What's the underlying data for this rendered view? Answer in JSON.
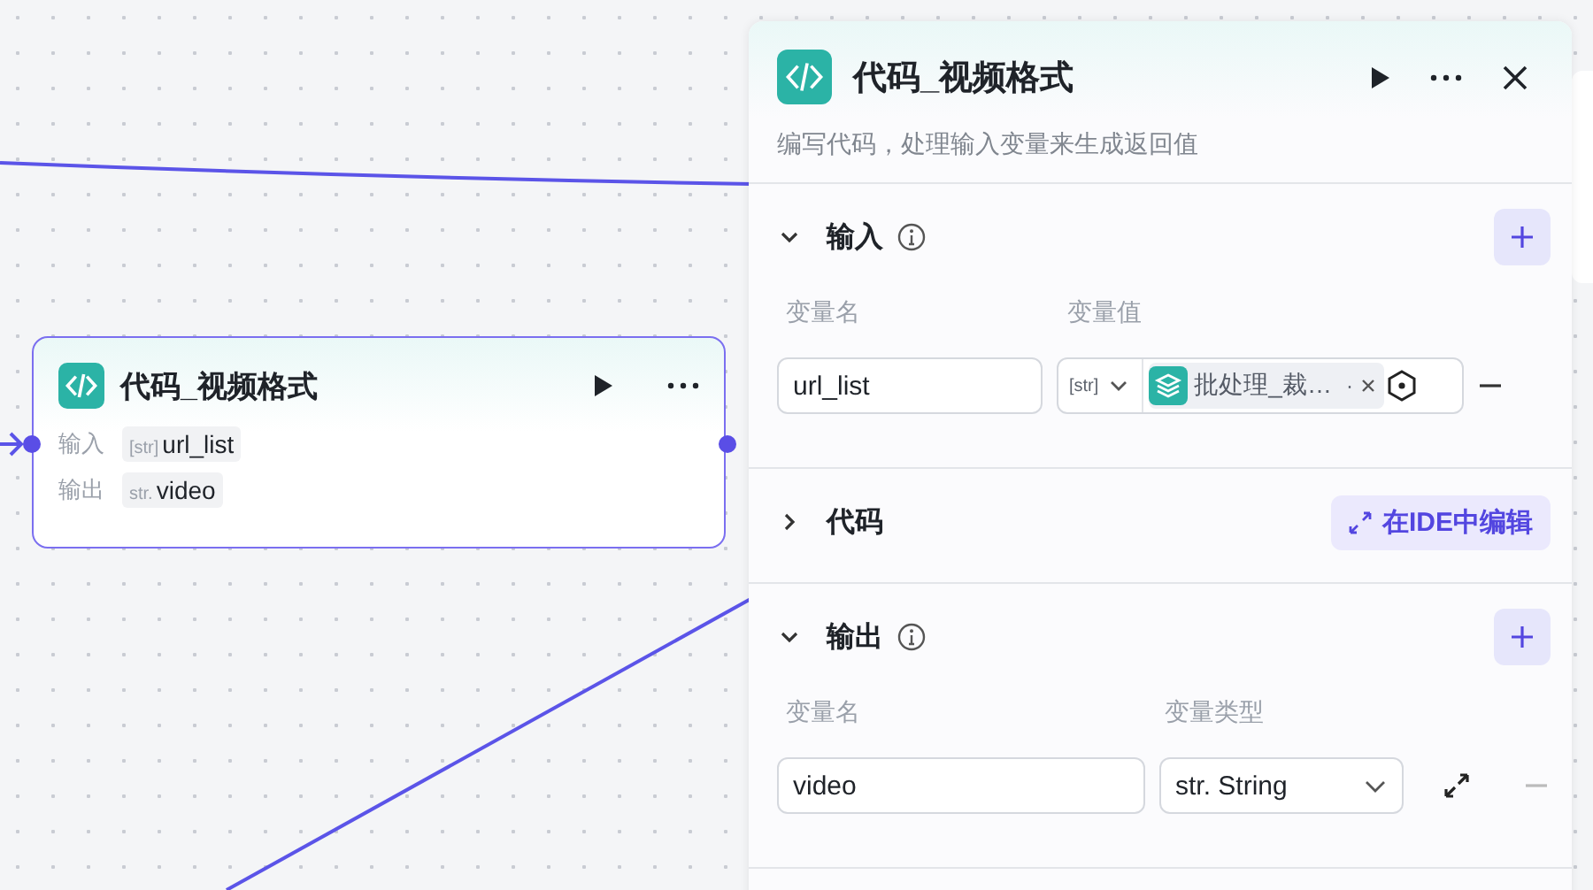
{
  "canvas": {
    "node": {
      "title": "代码_视频格式",
      "ports": [
        {
          "label": "输入",
          "type": "[str]",
          "name": "url_list"
        },
        {
          "label": "输出",
          "type": "str.",
          "name": "video"
        }
      ]
    }
  },
  "panel": {
    "title": "代码_视频格式",
    "description": "编写代码，处理输入变量来生成返回值",
    "sections": [
      {
        "kind": "input",
        "title": "输入",
        "expanded": true,
        "columns": [
          "变量名",
          "变量值"
        ],
        "rows": [
          {
            "name": "url_list",
            "type": "[str]",
            "ref": "批处理_裁…",
            "ref_suffix": "·"
          }
        ]
      },
      {
        "kind": "code",
        "title": "代码",
        "expanded": false,
        "action": "在IDE中编辑"
      },
      {
        "kind": "output",
        "title": "输出",
        "expanded": true,
        "columns": [
          "变量名",
          "变量类型"
        ],
        "rows": [
          {
            "name": "video",
            "type": "str. String"
          }
        ]
      }
    ]
  }
}
